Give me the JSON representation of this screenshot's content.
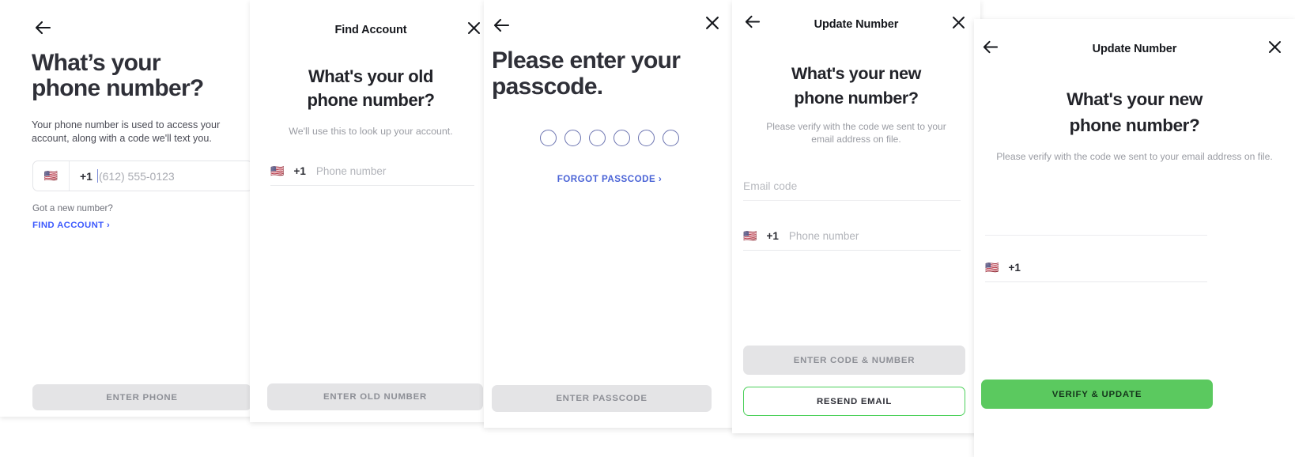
{
  "screens": [
    {
      "id": "enter-phone",
      "nav": {
        "back": "←",
        "title": "",
        "close": ""
      },
      "heading": "What’s your\nphone number?",
      "subtitle": "Your phone number is used to access your account, along with a code we'll text you.",
      "field": {
        "flag": "🇺🇸",
        "country_code": "+1",
        "placeholder": "(612) 555-0123",
        "value": ""
      },
      "helper_label": "Got a new number?",
      "helper_link": "FIND ACCOUNT ›",
      "cta": {
        "label": "ENTER PHONE",
        "state": "disabled"
      }
    },
    {
      "id": "find-account",
      "nav": {
        "back": "",
        "title": "Find Account",
        "close": "✕"
      },
      "heading": "What's your old\nphone number?",
      "subtitle": "We'll use this to look up your account.",
      "field": {
        "flag": "🇺🇸",
        "country_code": "+1",
        "placeholder": "Phone number",
        "value": ""
      },
      "cta": {
        "label": "ENTER OLD NUMBER",
        "state": "disabled"
      }
    },
    {
      "id": "enter-passcode",
      "nav": {
        "back": "←",
        "title": "",
        "close": "✕"
      },
      "heading": "Please enter your\npasscode.",
      "passcode_slots": 6,
      "forgot_link": "FORGOT PASSCODE ›",
      "cta": {
        "label": "ENTER PASSCODE",
        "state": "disabled"
      }
    },
    {
      "id": "update-number-code",
      "nav": {
        "back": "←",
        "title": "Update Number",
        "close": "✕"
      },
      "heading": "What's your new\nphone number?",
      "subtitle": "Please verify with the code we sent to your email address on file.",
      "email_code_field": {
        "placeholder": "Email code",
        "value": ""
      },
      "field": {
        "flag": "🇺🇸",
        "country_code": "+1",
        "placeholder": "Phone number",
        "value": ""
      },
      "cta": {
        "label": "ENTER CODE & NUMBER",
        "state": "disabled"
      },
      "secondary_cta": {
        "label": "RESEND EMAIL",
        "state": "outline"
      }
    },
    {
      "id": "update-number-verify",
      "nav": {
        "back": "←",
        "title": "Update Number",
        "close": "✕"
      },
      "heading": "What's your new\nphone number?",
      "subtitle": "Please verify with the code we sent to your email address on file.",
      "field": {
        "flag": "🇺🇸",
        "country_code": "+1",
        "placeholder": "",
        "value": ""
      },
      "cta": {
        "label": "VERIFY & UPDATE",
        "state": "primary"
      }
    }
  ],
  "colors": {
    "heading_dark": "#2f3038",
    "link_blue": "#3d5afe",
    "passcode_ring": "#6b73b0",
    "green_primary": "#5bc95f",
    "green_outline": "#4cd05a",
    "disabled_bg": "#e4e4e6",
    "disabled_text": "#8d8f96"
  }
}
